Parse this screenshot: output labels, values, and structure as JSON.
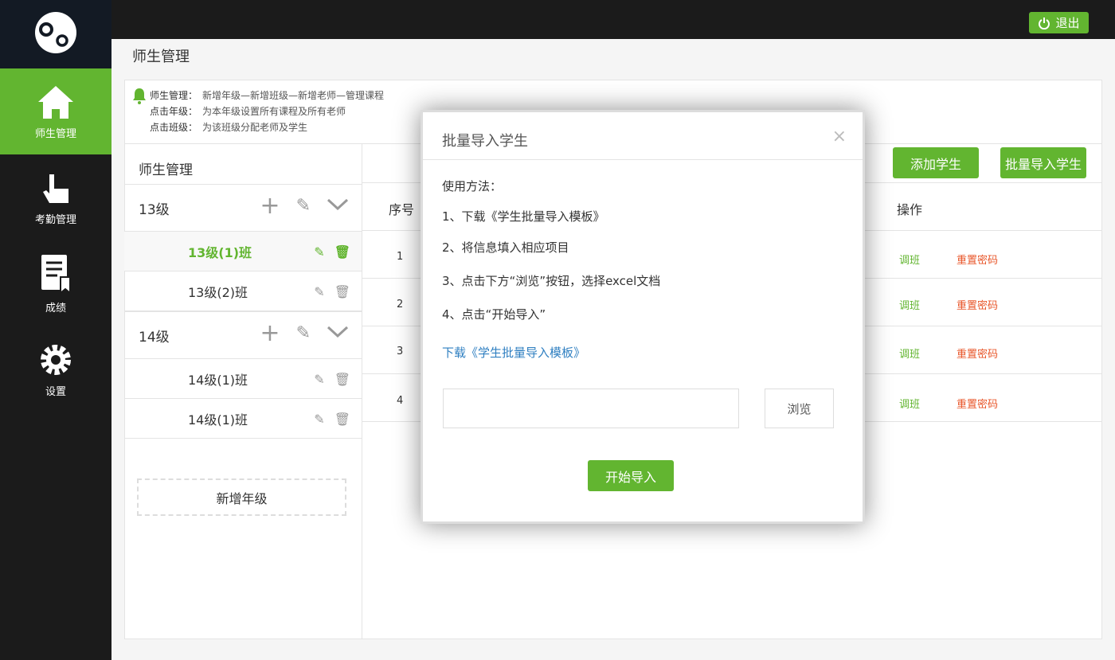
{
  "sidebar": {
    "items": [
      {
        "label": "师生管理",
        "icon": "home-icon"
      },
      {
        "label": "考勤管理",
        "icon": "hand-pointer-icon"
      },
      {
        "label": "成绩",
        "icon": "document-icon"
      },
      {
        "label": "设置",
        "icon": "gear-icon"
      }
    ]
  },
  "topbar": {
    "logout": "退出"
  },
  "page": {
    "title": "师生管理"
  },
  "notice": [
    {
      "k": "师生管理：",
      "v": "新增年级—新增班级—新增老师—管理课程"
    },
    {
      "k": "点击年级：",
      "v": "为本年级设置所有课程及所有老师"
    },
    {
      "k": "点击班级：",
      "v": "为该班级分配老师及学生"
    }
  ],
  "left": {
    "title": "师生管理",
    "grades": [
      {
        "name": "13级",
        "classes": [
          "13级(1)班",
          "13级(2)班"
        ]
      },
      {
        "name": "14级",
        "classes": [
          "14级(1)班",
          "14级(1)班"
        ]
      }
    ],
    "add_grade": "新增年级"
  },
  "right": {
    "add_student": "添加学生",
    "batch_import": "批量导入学生",
    "headers": {
      "no": "序号",
      "op": "操作"
    },
    "rows": [
      {
        "no": "1",
        "move": "调班",
        "reset": "重置密码"
      },
      {
        "no": "2",
        "move": "调班",
        "reset": "重置密码"
      },
      {
        "no": "3",
        "move": "调班",
        "reset": "重置密码"
      },
      {
        "no": "4",
        "move": "调班",
        "reset": "重置密码"
      }
    ]
  },
  "modal": {
    "title": "批量导入学生",
    "close": "×",
    "usage": "使用方法：",
    "steps": [
      "1、下载《学生批量导入模板》",
      "2、将信息填入相应项目",
      "3、点击下方“浏览”按钮，选择excel文档",
      "4、点击“开始导入”"
    ],
    "download_link": "下载《学生批量导入模板》",
    "file_value": "",
    "browse": "浏览",
    "start": "开始导入"
  },
  "colors": {
    "accent": "#62b530",
    "danger": "#e8562a",
    "link": "#2f7fc1"
  }
}
